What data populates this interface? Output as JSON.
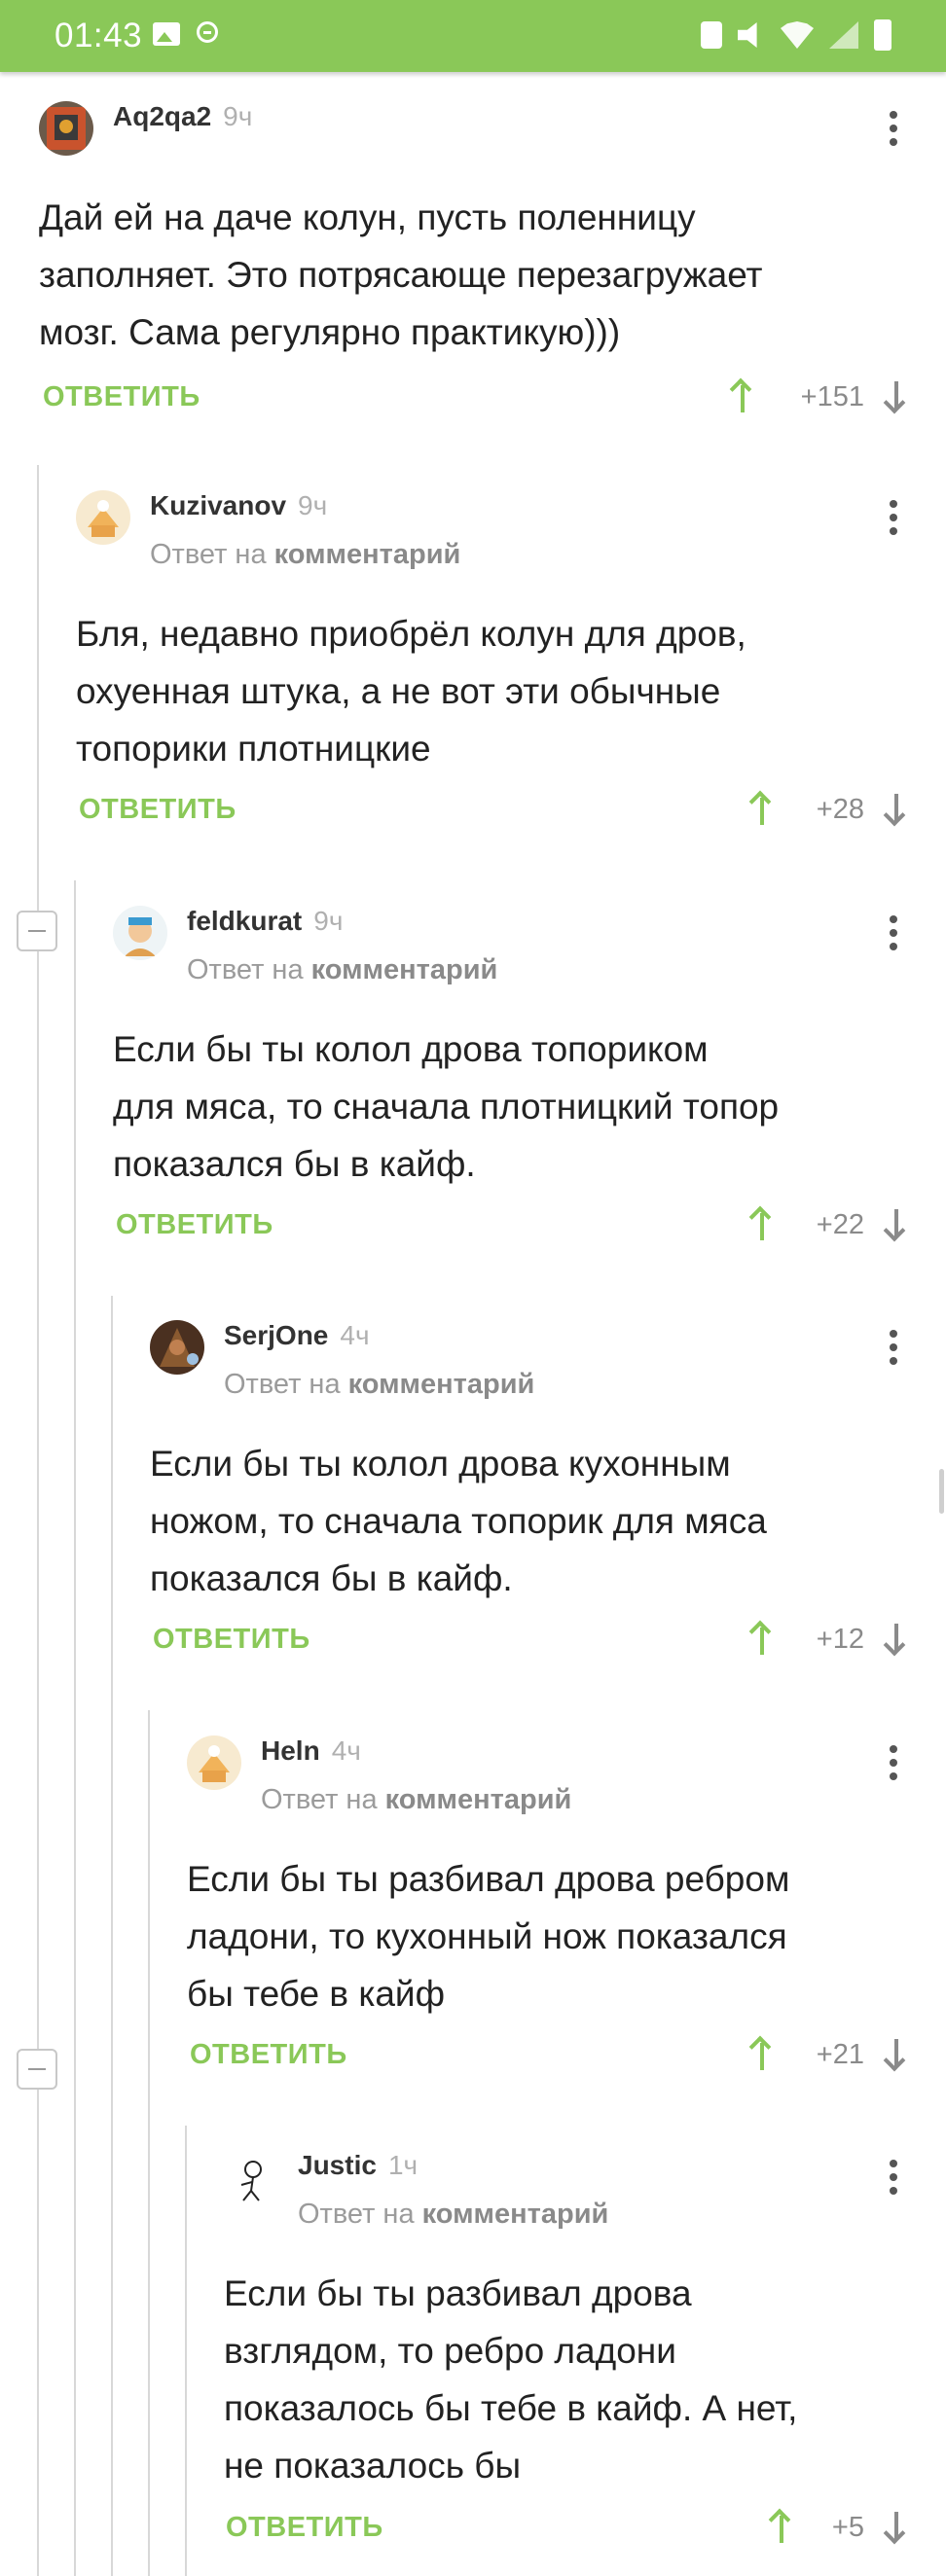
{
  "status_bar": {
    "time": "01:43"
  },
  "reply_label": "ОТВЕТИТЬ",
  "reply_to_prefix": "Ответ на",
  "reply_to_link": "комментарий",
  "colors": {
    "accent": "#8ac858",
    "text": "#222222",
    "muted": "#9b9b9b"
  },
  "comments": [
    {
      "user": "Aq2qa2",
      "time": "9ч",
      "reply_to": false,
      "text": "Дай ей на даче колун, пусть поленницу\nзаполняет. Это потрясающе перезагружает\nмозг. Сама регулярно практикую)))",
      "rating": "+151"
    },
    {
      "user": "Kuzivanov",
      "time": "9ч",
      "reply_to": true,
      "text": "Бля, недавно приобрёл колун для дров,\nохуенная штука, а не вот эти обычные\nтопорики плотницкие",
      "rating": "+28"
    },
    {
      "user": "feldkurat",
      "time": "9ч",
      "reply_to": true,
      "text": "Если бы ты колол дрова топориком\nдля мяса, то сначала плотницкий топор\nпоказался бы в кайф.",
      "rating": "+22"
    },
    {
      "user": "SerjOne",
      "time": "4ч",
      "reply_to": true,
      "text": "Если бы ты колол дрова кухонным\nножом, то сначала топорик для мяса\nпоказался бы в кайф.",
      "rating": "+12"
    },
    {
      "user": "Heln",
      "time": "4ч",
      "reply_to": true,
      "text": "Если бы ты разбивал дрова ребром\nладони, то кухонный нож показался\nбы тебе в кайф",
      "rating": "+21"
    },
    {
      "user": "Justic",
      "time": "1ч",
      "reply_to": true,
      "text": "Если бы ты разбивал дрова\nвзглядом, то ребро ладони\nпоказалось бы тебе в кайф. А нет,\nне показалось бы",
      "rating": "+5"
    }
  ]
}
